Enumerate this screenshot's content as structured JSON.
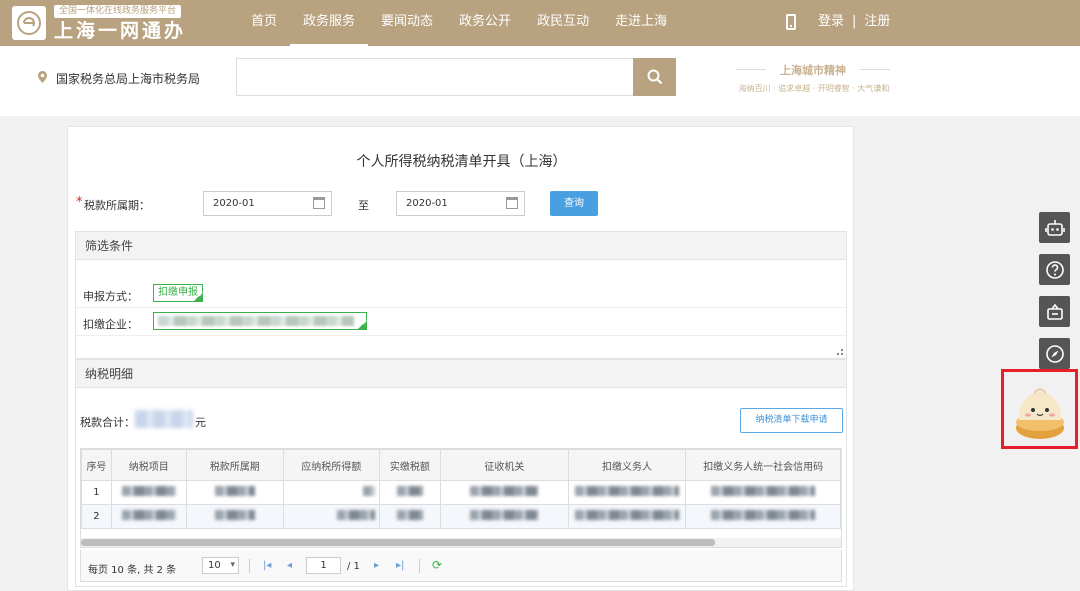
{
  "header": {
    "platform_tag": "全国一体化在线政务服务平台",
    "site_name": "上海一网通办",
    "nav": [
      {
        "label": "首页",
        "active": false
      },
      {
        "label": "政务服务",
        "active": true
      },
      {
        "label": "要闻动态",
        "active": false
      },
      {
        "label": "政务公开",
        "active": false
      },
      {
        "label": "政民互动",
        "active": false
      },
      {
        "label": "走进上海",
        "active": false
      }
    ],
    "login": "登录",
    "separator": "|",
    "register": "注册",
    "brand_color": "#b9a27f"
  },
  "subheader": {
    "location": "国家税务总局上海市税务局",
    "search_value": "",
    "brand_title": "上海城市精神",
    "brand_sub": "海纳百川 · 追求卓越 · 开明睿智 · 大气谦和"
  },
  "form": {
    "title": "个人所得税纳税清单开具（上海）",
    "required_mark": "*",
    "period_label": "税款所属期：",
    "start": "2020-01",
    "to": "至",
    "end": "2020-01",
    "query": "查询"
  },
  "filter": {
    "title": "筛选条件",
    "declare_label": "申报方式：",
    "declare_value": "扣缴申报",
    "company_label": "扣缴企业："
  },
  "detail": {
    "title": "纳税明细",
    "sum_label": "税款合计：",
    "sum_unit": "元",
    "download": "纳税清单下载申请",
    "columns": [
      "序号",
      "纳税项目",
      "税款所属期",
      "应纳税所得额",
      "实缴税额",
      "征收机关",
      "扣缴义务人",
      "扣缴义务人统一社会信用码"
    ],
    "rows": [
      {
        "no": "1"
      },
      {
        "no": "2"
      }
    ]
  },
  "pager": {
    "summary": "每页 10 条, 共 2 条",
    "page_size": "10",
    "page": "1",
    "total": "/ 1",
    "first_icon": "first-page-icon",
    "prev_icon": "prev-page-icon",
    "next_icon": "next-page-icon",
    "last_icon": "last-page-icon",
    "refresh_icon": "refresh-icon"
  },
  "side_tools": [
    "robot-icon",
    "help-icon",
    "service-icon",
    "compass-icon",
    "mascot-icon"
  ]
}
